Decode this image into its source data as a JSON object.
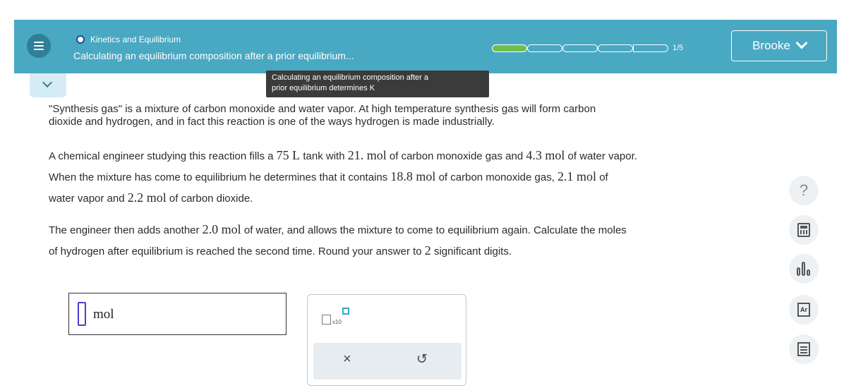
{
  "header": {
    "topic": "Kinetics and Equilibrium",
    "subtitle": "Calculating an equilibrium composition after a prior equilibrium...",
    "progress_text": "1/5",
    "progress_fraction": 0.2,
    "user_name": "Brooke",
    "colors": {
      "header_bg": "#49a8c2",
      "progress_fill": "#6dbf4b"
    }
  },
  "tooltip": {
    "line1": "Calculating an equilibrium composition after a",
    "line2": "prior equilibrium determines K"
  },
  "problem": {
    "p1_line1": "\"Synthesis gas\" is a mixture of carbon monoxide and water vapor. At high temperature synthesis gas will form carbon",
    "p1_line2": "dioxide and hydrogen, and in fact this reaction is one of the ways hydrogen is made industrially.",
    "p2": {
      "t1": "A chemical engineer studying this reaction fills a ",
      "m1": "75 L",
      "t2": " tank with ",
      "m2": "21. mol",
      "t3": " of carbon monoxide gas and ",
      "m3": "4.3 mol",
      "t4": " of water vapor.",
      "t5": "When the mixture has come to equilibrium he determines that it contains ",
      "m4": "18.8 mol",
      "t6": " of carbon monoxide gas, ",
      "m5": "2.1 mol",
      "t7": " of",
      "t8": "water vapor and ",
      "m6": "2.2 mol",
      "t9": " of carbon dioxide."
    },
    "p3": {
      "t1": "The engineer then adds another ",
      "m1": "2.0 mol",
      "t2": " of water, and allows the mixture to come to equilibrium again. Calculate the moles",
      "t3": "of hydrogen after equilibrium is reached the second time. Round your answer to ",
      "m2": "2",
      "t4": " significant digits."
    }
  },
  "answer": {
    "value": "",
    "unit": "mol"
  },
  "keypad": {
    "sci_label": "x10",
    "clear_symbol": "×",
    "undo_symbol": "↺"
  },
  "tools": {
    "help_symbol": "?",
    "periodic_label": "Ar",
    "icons": [
      "help-icon",
      "calculator-icon",
      "data-icon",
      "periodic-table-icon",
      "reference-icon"
    ]
  }
}
